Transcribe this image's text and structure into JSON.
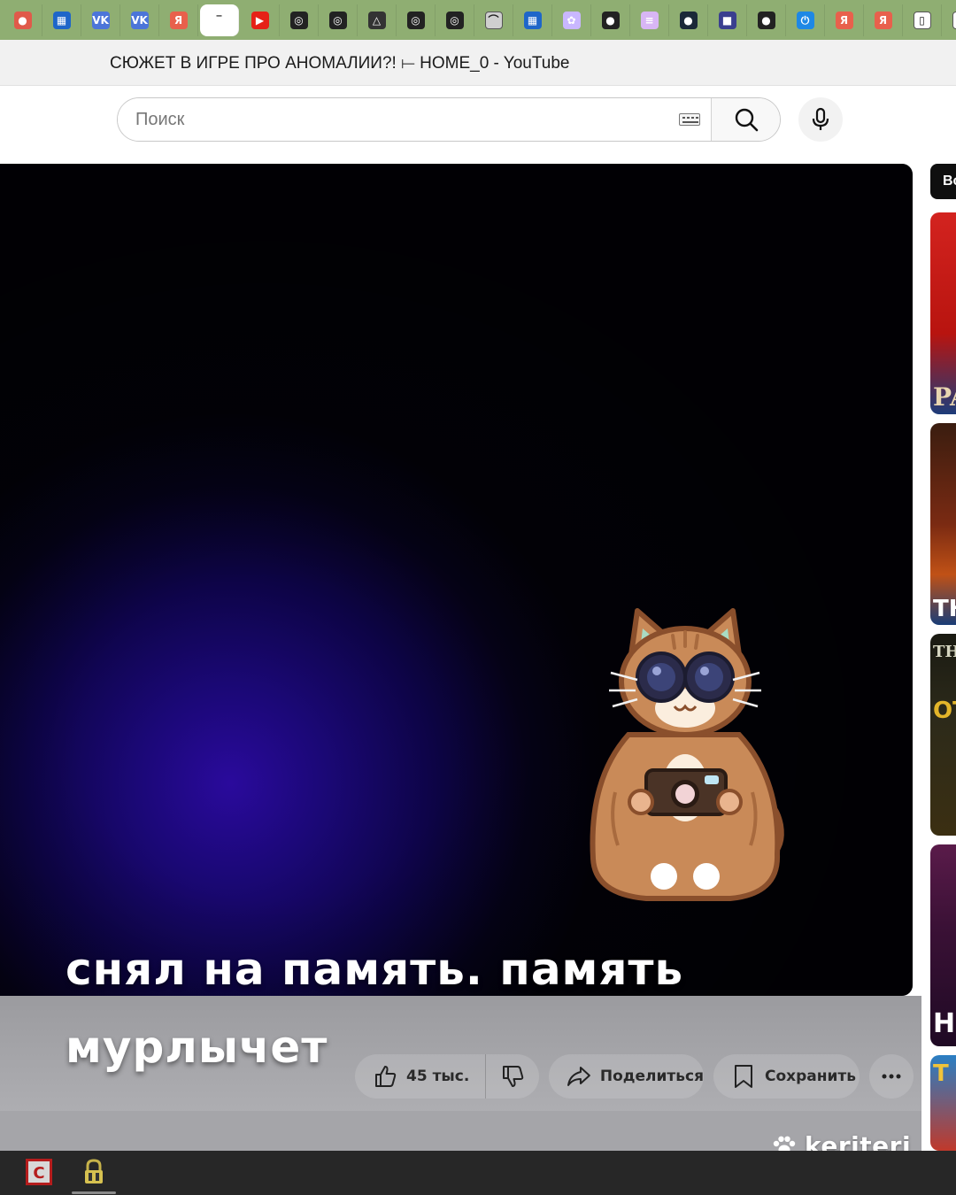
{
  "browser": {
    "tabs": [
      {
        "icon": "red-avatar-icon",
        "color": "#e05a4a",
        "glyph": "●"
      },
      {
        "icon": "windows-store-icon",
        "color": "#1e66c9",
        "glyph": "▦"
      },
      {
        "icon": "vk-icon",
        "color": "#4c75d9",
        "glyph": "VK"
      },
      {
        "icon": "vk-icon",
        "color": "#4c75d9",
        "glyph": "VK"
      },
      {
        "icon": "yandex-icon",
        "color": "#e8604c",
        "glyph": "Я"
      },
      {
        "icon": "blank-page-icon",
        "color": "#ffffff",
        "glyph": "‾",
        "active": true
      },
      {
        "icon": "youtube-icon",
        "color": "#e62117",
        "glyph": "▶"
      },
      {
        "icon": "github-icon",
        "color": "#222222",
        "glyph": "◎"
      },
      {
        "icon": "github-icon",
        "color": "#222222",
        "glyph": "◎"
      },
      {
        "icon": "alice-icon",
        "color": "#333333",
        "glyph": "△"
      },
      {
        "icon": "github-icon",
        "color": "#222222",
        "glyph": "◎"
      },
      {
        "icon": "github-icon",
        "color": "#222222",
        "glyph": "◎"
      },
      {
        "icon": "cloud-drive-icon",
        "color": "#cfcfcf",
        "glyph": "⌒"
      },
      {
        "icon": "windows-store-icon",
        "color": "#1e66c9",
        "glyph": "▦"
      },
      {
        "icon": "pixel-art-icon",
        "color": "#c9b7ff",
        "glyph": "✿"
      },
      {
        "icon": "cat-icon",
        "color": "#222222",
        "glyph": "●"
      },
      {
        "icon": "notes-icon",
        "color": "#d8b6f5",
        "glyph": "≡"
      },
      {
        "icon": "steam-icon",
        "color": "#1b2838",
        "glyph": "●"
      },
      {
        "icon": "game-icon",
        "color": "#3a3f8f",
        "glyph": "■"
      },
      {
        "icon": "cat-icon",
        "color": "#222222",
        "glyph": "●"
      },
      {
        "icon": "power-icon",
        "color": "#1e88e5",
        "glyph": "⏻"
      },
      {
        "icon": "yandex-icon",
        "color": "#e8604c",
        "glyph": "Я"
      },
      {
        "icon": "yandex-icon",
        "color": "#e8604c",
        "glyph": "Я"
      },
      {
        "icon": "document-icon",
        "color": "#ffffff",
        "glyph": "▯"
      },
      {
        "icon": "new-tab-icon",
        "color": "#ffffff",
        "glyph": "+"
      }
    ],
    "window_title": "СЮЖЕТ В ИГРЕ ПРО АНОМАЛИИ?! ⟝ HOME_0 - YouTube"
  },
  "youtube": {
    "search": {
      "placeholder": "Поиск",
      "value": ""
    },
    "actions": {
      "like_count": "45 тыс.",
      "share_label": "Поделиться",
      "save_label": "Сохранить"
    },
    "sidebar_chip": "Вс",
    "thumb_texts": [
      "PA",
      "TH",
      "THE",
      "OT",
      "H",
      "T"
    ]
  },
  "caption": {
    "line1": "снял на память. память",
    "line2": "мурлычет"
  },
  "watermark": "keriteri",
  "colors": {
    "tab_strip": "#8fae72",
    "player_glow": "#2a0a9c",
    "taskbar": "#272727"
  }
}
